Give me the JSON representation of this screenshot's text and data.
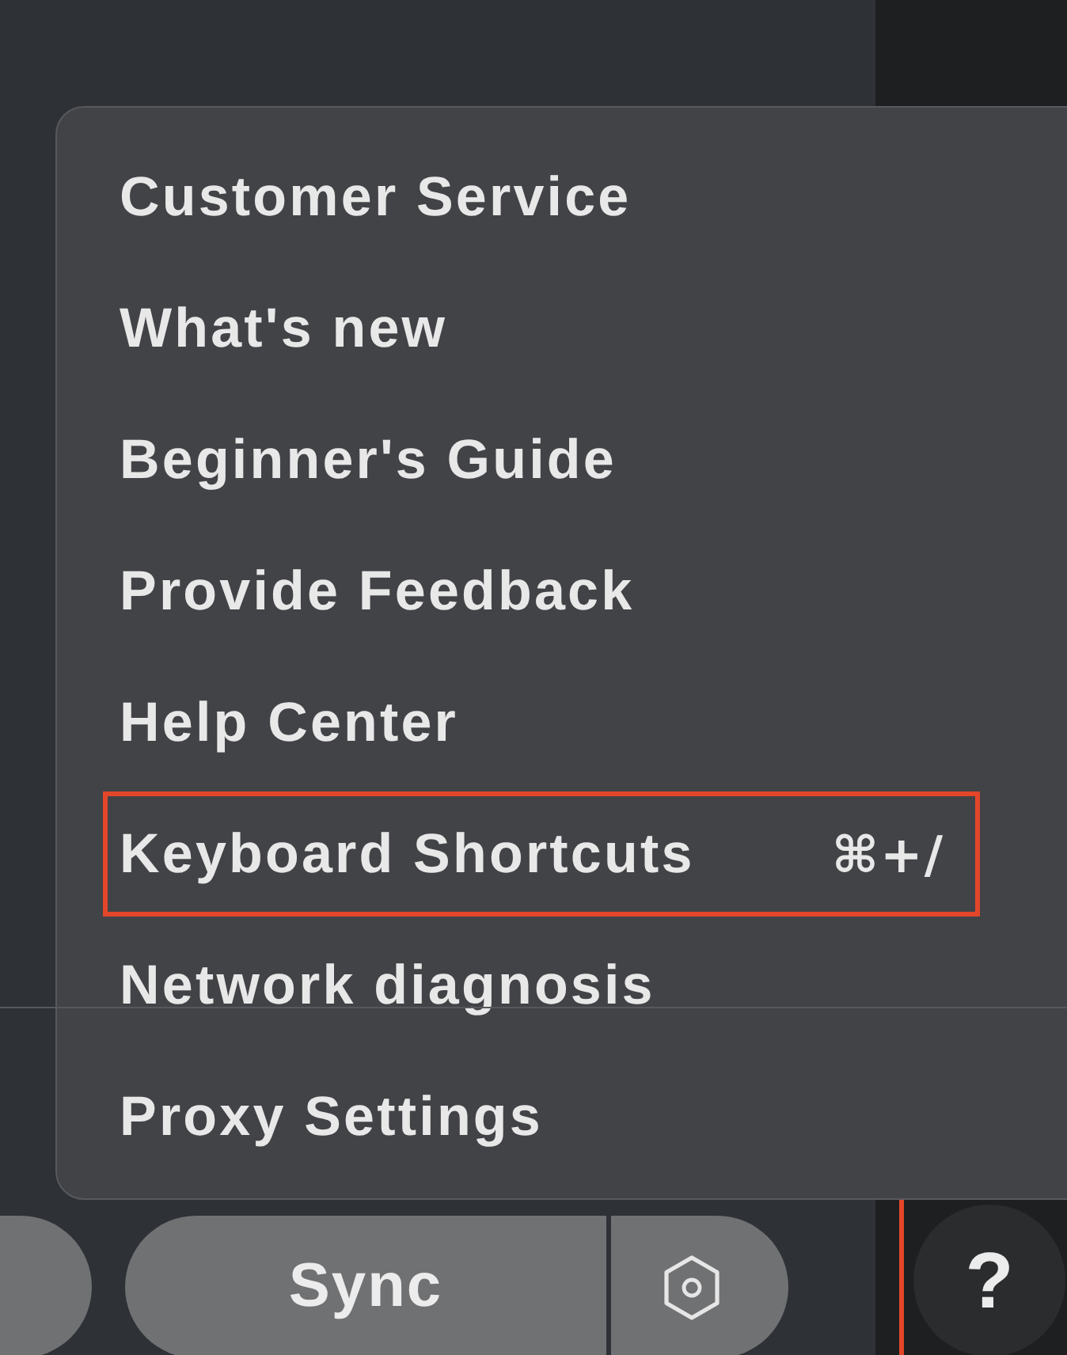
{
  "help_menu": {
    "items": [
      {
        "label": "Customer Service",
        "highlighted": false
      },
      {
        "label": "What's new",
        "highlighted": false
      },
      {
        "label": "Beginner's Guide",
        "highlighted": false
      },
      {
        "label": "Provide Feedback",
        "highlighted": false
      },
      {
        "label": "Help Center",
        "highlighted": false
      },
      {
        "label": "Keyboard Shortcuts",
        "shortcut": "⌘+/",
        "highlighted": true
      },
      {
        "label": "Network diagnosis",
        "highlighted": false
      },
      {
        "label": "Proxy Settings",
        "highlighted": false
      }
    ]
  },
  "toolbar": {
    "sync_button": {
      "label": "Sync"
    }
  },
  "help_button": {
    "label": "?",
    "highlighted": true
  }
}
